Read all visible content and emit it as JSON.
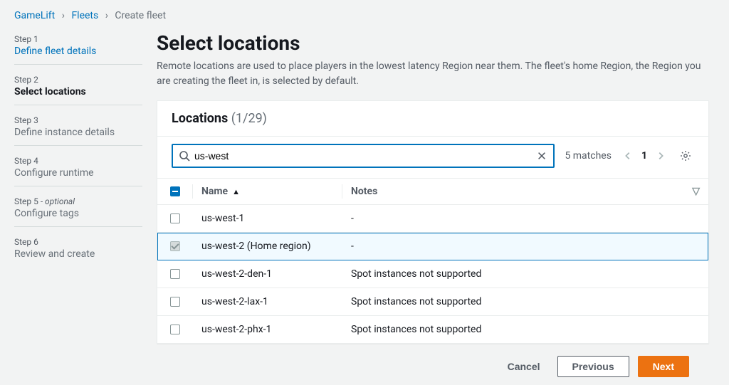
{
  "breadcrumb": [
    {
      "label": "GameLift",
      "link": true
    },
    {
      "label": "Fleets",
      "link": true
    },
    {
      "label": "Create fleet",
      "link": false
    }
  ],
  "steps": [
    {
      "label": "Step 1",
      "title": "Define fleet details",
      "state": "link"
    },
    {
      "label": "Step 2",
      "title": "Select locations",
      "state": "current"
    },
    {
      "label": "Step 3",
      "title": "Define instance details",
      "state": "future"
    },
    {
      "label": "Step 4",
      "title": "Configure runtime",
      "state": "future"
    },
    {
      "label": "Step 5",
      "optional": "- optional",
      "title": "Configure tags",
      "state": "future"
    },
    {
      "label": "Step 6",
      "title": "Review and create",
      "state": "future"
    }
  ],
  "page": {
    "title": "Select locations",
    "desc": "Remote locations are used to place players in the lowest latency Region near them. The fleet's home Region, the Region you are creating the fleet in, is selected by default."
  },
  "locations": {
    "header_title": "Locations",
    "header_count": "(1/29)",
    "search_value": "us-west",
    "matches": "5 matches",
    "page_number": "1",
    "columns": {
      "name": "Name",
      "notes": "Notes"
    },
    "rows": [
      {
        "name": "us-west-1",
        "notes": "-",
        "selected": false,
        "disabled": false
      },
      {
        "name": "us-west-2 (Home region)",
        "notes": "-",
        "selected": true,
        "disabled": true
      },
      {
        "name": "us-west-2-den-1",
        "notes": "Spot instances not supported",
        "selected": false,
        "disabled": false
      },
      {
        "name": "us-west-2-lax-1",
        "notes": "Spot instances not supported",
        "selected": false,
        "disabled": false
      },
      {
        "name": "us-west-2-phx-1",
        "notes": "Spot instances not supported",
        "selected": false,
        "disabled": false
      }
    ]
  },
  "footer": {
    "cancel": "Cancel",
    "previous": "Previous",
    "next": "Next"
  }
}
